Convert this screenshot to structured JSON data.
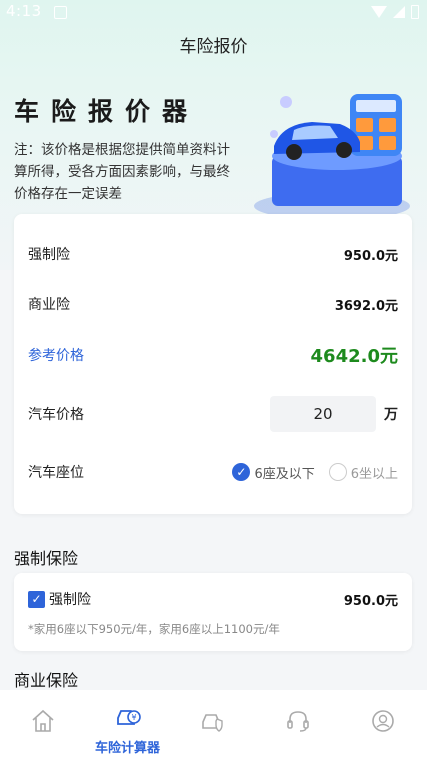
{
  "status": {
    "time": "4:13"
  },
  "nav": {
    "title": "车险报价"
  },
  "hero": {
    "title": "车险报价器",
    "note": "注：该价格是根据您提供简单资料计算所得，受各方面因素影响，与最终价格存在一定误差"
  },
  "summary": {
    "compulsory_label": "强制险",
    "compulsory_value": "950.0元",
    "commercial_label": "商业险",
    "commercial_value": "3692.0元",
    "reference_label": "参考价格",
    "reference_value": "4642.0元",
    "car_price_label": "汽车价格",
    "car_price_value": "20",
    "car_price_unit": "万",
    "seats_label": "汽车座位",
    "seat_options": [
      "6座及以下",
      "6坐以上"
    ],
    "seat_selected": "6座及以下"
  },
  "compulsory_section": {
    "title": "强制保险",
    "item_label": "强制险",
    "item_value": "950.0元",
    "item_checked": true,
    "hint": "*家用6座以下950元/年，家用6座以上1100元/年"
  },
  "commercial_section": {
    "title": "商业保险"
  },
  "tabbar": {
    "items": [
      {
        "icon": "home-icon",
        "label": ""
      },
      {
        "icon": "car-calculator-icon",
        "label": "车险计算器",
        "active": true
      },
      {
        "icon": "car-insurance-icon",
        "label": ""
      },
      {
        "icon": "headset-icon",
        "label": ""
      },
      {
        "icon": "user-icon",
        "label": ""
      }
    ]
  },
  "colors": {
    "accent": "#2e64d9",
    "price_green": "#1d8a1d"
  }
}
